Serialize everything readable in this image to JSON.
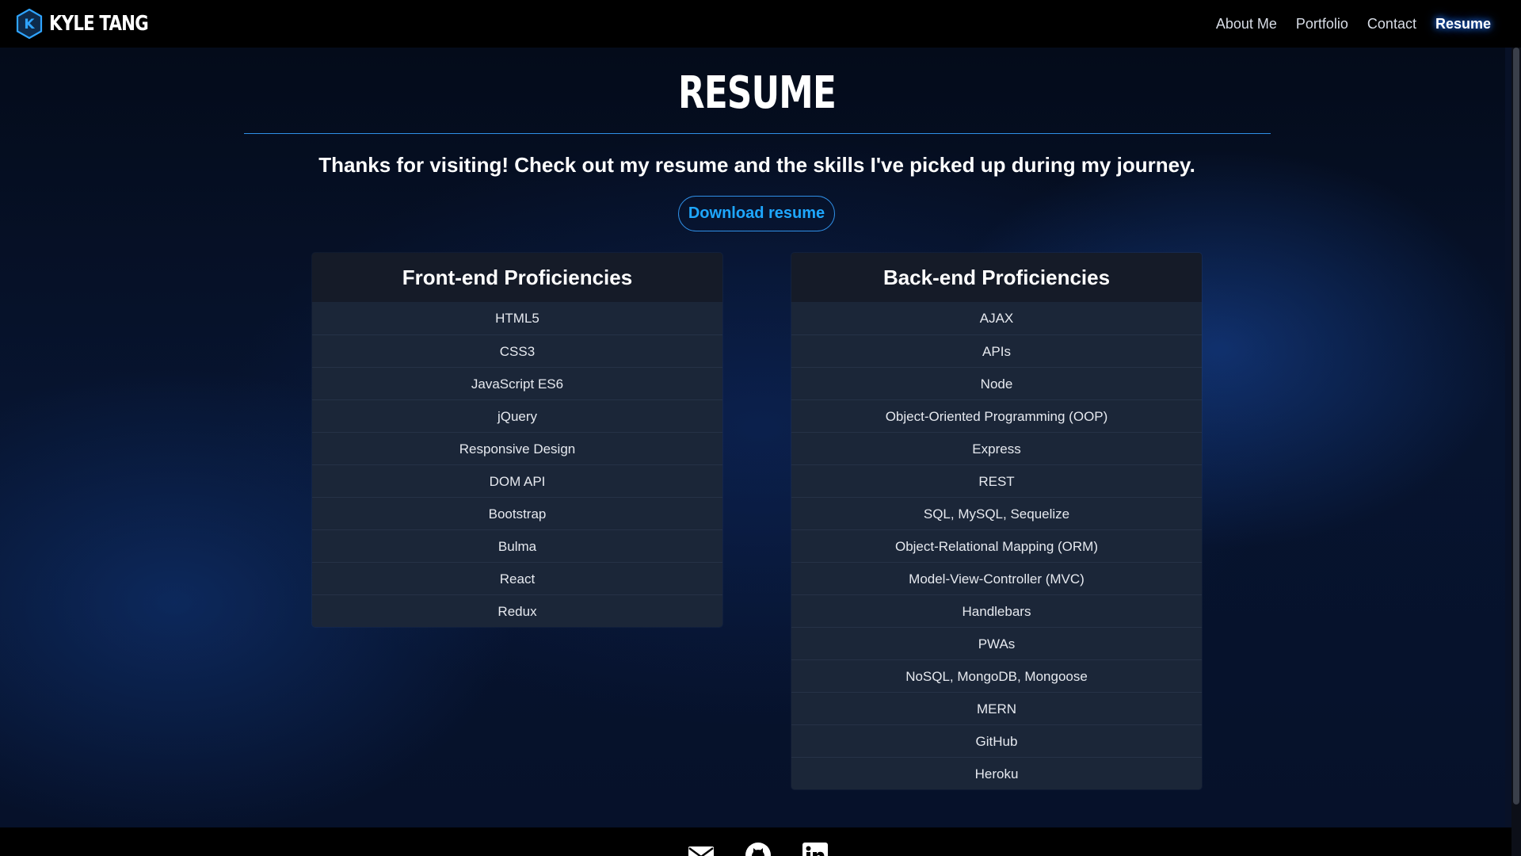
{
  "navbar": {
    "brand_letter": "K",
    "brand_name": "KYLE TANG",
    "links": [
      {
        "label": "About Me",
        "active": false
      },
      {
        "label": "Portfolio",
        "active": false
      },
      {
        "label": "Contact",
        "active": false
      },
      {
        "label": "Resume",
        "active": true
      }
    ]
  },
  "main": {
    "title": "RESUME",
    "subtitle": "Thanks for visiting! Check out my resume and the skills I've picked up during my journey.",
    "download_label": "Download resume",
    "frontend": {
      "title": "Front-end Proficiencies",
      "items": [
        "HTML5",
        "CSS3",
        "JavaScript ES6",
        "jQuery",
        "Responsive Design",
        "DOM API",
        "Bootstrap",
        "Bulma",
        "React",
        "Redux"
      ]
    },
    "backend": {
      "title": "Back-end Proficiencies",
      "items": [
        "AJAX",
        "APIs",
        "Node",
        "Object-Oriented Programming (OOP)",
        "Express",
        "REST",
        "SQL, MySQL, Sequelize",
        "Object-Relational Mapping (ORM)",
        "Model-View-Controller (MVC)",
        "Handlebars",
        "PWAs",
        "NoSQL, MongoDB, Mongoose",
        "MERN",
        "GitHub",
        "Heroku"
      ]
    }
  },
  "footer": {
    "icons": [
      "email-icon",
      "github-icon",
      "linkedin-icon"
    ]
  },
  "colors": {
    "accent": "#2f8fe6",
    "button_text": "#1ea7ff",
    "card_bg": "#1b2638",
    "card_header_bg": "#151b28"
  }
}
